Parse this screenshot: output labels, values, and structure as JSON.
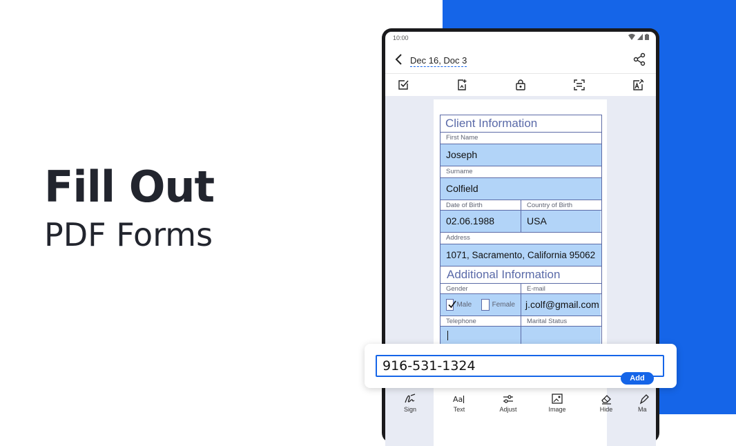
{
  "headline": {
    "line1": "Fill Out",
    "line2": "PDF Forms"
  },
  "statusbar": {
    "time": "10:00"
  },
  "appbar": {
    "title": "Dec 16, Doc 3"
  },
  "toolbar": {
    "icons": [
      "check-icon",
      "add-page-icon",
      "lock-icon",
      "scan-icon",
      "ai-edit-icon"
    ]
  },
  "form": {
    "client_info_title": "Client Information",
    "first_name_label": "First Name",
    "first_name_value": "Joseph",
    "surname_label": "Surname",
    "surname_value": "Colfield",
    "dob_label": "Date of Birth",
    "dob_value": "02.06.1988",
    "country_label": "Country of Birth",
    "country_value": "USA",
    "address_label": "Address",
    "address_value": "1071, Sacramento, California 95062",
    "additional_info_title": "Additional Information",
    "gender_label": "Gender",
    "male_label": "Male",
    "female_label": "Female",
    "email_label": "E-mail",
    "email_value": "j.colf@gmail.com",
    "telephone_label": "Telephone",
    "marital_label": "Marital Status"
  },
  "input": {
    "value": "916-531-1324",
    "add_label": "Add"
  },
  "bottom_bar": {
    "sign": "Sign",
    "text": "Text",
    "adjust": "Adjust",
    "image": "Image",
    "hide": "Hide",
    "more": "Ma"
  },
  "colors": {
    "accent": "#1565e8",
    "field_fill": "#b2d4f8",
    "border": "#5b6aa6"
  }
}
